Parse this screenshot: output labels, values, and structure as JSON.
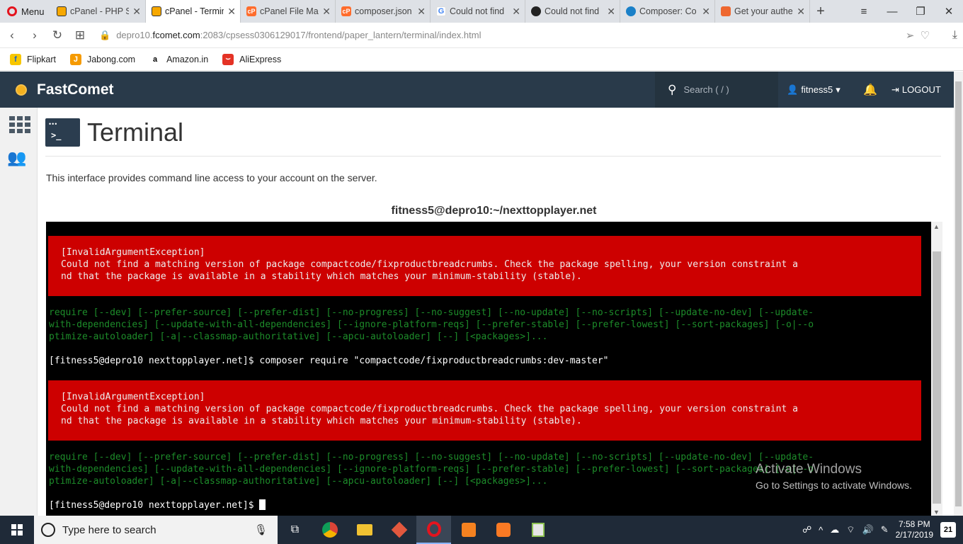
{
  "browser": {
    "menu_label": "Menu",
    "tabs": [
      {
        "label": "cPanel - PHP S",
        "icon": "cpanel-icon"
      },
      {
        "label": "cPanel - Termin",
        "icon": "cpanel-icon"
      },
      {
        "label": "cPanel File Ma",
        "icon": "cpanel-file-manager-icon"
      },
      {
        "label": "composer.json",
        "icon": "cpanel-file-manager-icon"
      },
      {
        "label": "Could not find",
        "icon": "google-icon"
      },
      {
        "label": "Could not find",
        "icon": "github-icon"
      },
      {
        "label": "Composer: Co",
        "icon": "drupal-icon"
      },
      {
        "label": "Get your authe",
        "icon": "magento-icon"
      }
    ],
    "url_host": "depro10.fcomet.com",
    "url_port_path": ":2083/cpsess0306129017/frontend/paper_lantern/terminal/index.html",
    "url_prefix": "depro10."
  },
  "bookmarks": [
    {
      "label": "Flipkart",
      "color": "#f7c600"
    },
    {
      "label": "Jabong.com",
      "color": "#f59a00"
    },
    {
      "label": "Amazon.in",
      "color": "#000000"
    },
    {
      "label": "AliExpress",
      "color": "#e43225"
    }
  ],
  "header": {
    "brand": "FastComet",
    "search_placeholder": "Search ( / )",
    "user": "fitness5",
    "logout": "LOGOUT"
  },
  "page": {
    "title": "Terminal",
    "description": "This interface provides command line access to your account on the server.",
    "host": "fitness5@depro10:~/nexttopplayer.net"
  },
  "terminal": {
    "error_block_1": "[InvalidArgumentException]\nCould not find a matching version of package compactcode/fixproductbreadcrumbs. Check the package spelling, your version constraint a\nnd that the package is available in a stability which matches your minimum-stability (stable).",
    "usage_1": "require [--dev] [--prefer-source] [--prefer-dist] [--no-progress] [--no-suggest] [--no-update] [--no-scripts] [--update-no-dev] [--update-\nwith-dependencies] [--update-with-all-dependencies] [--ignore-platform-reqs] [--prefer-stable] [--prefer-lowest] [--sort-packages] [-o|--o\nptimize-autoloader] [-a|--classmap-authoritative] [--apcu-autoloader] [--] [<packages>]...",
    "command_line": "[fitness5@depro10 nexttopplayer.net]$ composer require \"compactcode/fixproductbreadcrumbs:dev-master\"",
    "error_block_2": "[InvalidArgumentException]\nCould not find a matching version of package compactcode/fixproductbreadcrumbs. Check the package spelling, your version constraint a\nnd that the package is available in a stability which matches your minimum-stability (stable).",
    "usage_2": "require [--dev] [--prefer-source] [--prefer-dist] [--no-progress] [--no-suggest] [--no-update] [--no-scripts] [--update-no-dev] [--update-\nwith-dependencies] [--update-with-all-dependencies] [--ignore-platform-reqs] [--prefer-stable] [--prefer-lowest] [--sort-packages] [-o|--o\nptimize-autoloader] [-a|--classmap-authoritative] [--apcu-autoloader] [--] [<packages>]...",
    "prompt": "[fitness5@depro10 nexttopplayer.net]$ "
  },
  "watermark": {
    "line1": "Activate Windows",
    "line2": "Go to Settings to activate Windows."
  },
  "taskbar": {
    "search_placeholder": "Type here to search",
    "time": "7:58 PM",
    "date": "2/17/2019",
    "notifications": "21"
  }
}
